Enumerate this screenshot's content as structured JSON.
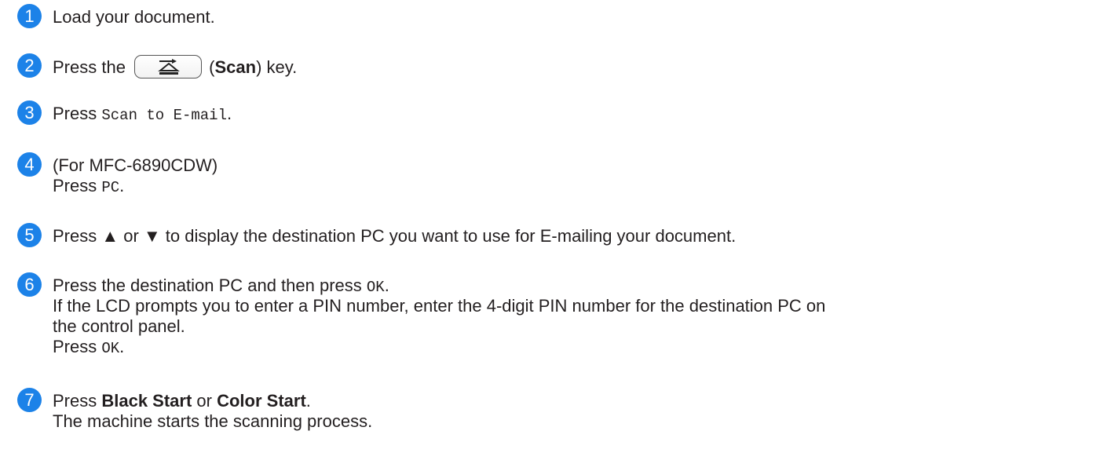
{
  "accent_color": "#1c82e8",
  "steps": [
    {
      "number": "1",
      "text": "Load your document."
    },
    {
      "number": "2",
      "prefix": "Press the ",
      "key_icon": "scan-key-icon",
      "paren_open": " (",
      "bold": "Scan",
      "suffix": ") key."
    },
    {
      "number": "3",
      "prefix": "Press ",
      "code": "Scan to E-mail",
      "suffix": "."
    },
    {
      "number": "4",
      "line1": "(For MFC-6890CDW)",
      "prefix": "Press ",
      "code": "PC",
      "suffix": "."
    },
    {
      "number": "5",
      "text": "Press ▲ or ▼ to display the destination PC you want to use for E-mailing your document."
    },
    {
      "number": "6",
      "prefix": "Press the destination PC and then press ",
      "code": "OK",
      "suffix": ".",
      "line2": "If the LCD prompts you to enter a PIN number, enter the 4-digit PIN number for the destination PC on",
      "line3": "the control panel.",
      "line4_prefix": "Press ",
      "line4_code": "OK",
      "line4_suffix": "."
    },
    {
      "number": "7",
      "prefix": "Press ",
      "bold1": "Black Start",
      "mid": " or ",
      "bold2": "Color Start",
      "suffix": ".",
      "line2": "The machine starts the scanning process."
    }
  ]
}
